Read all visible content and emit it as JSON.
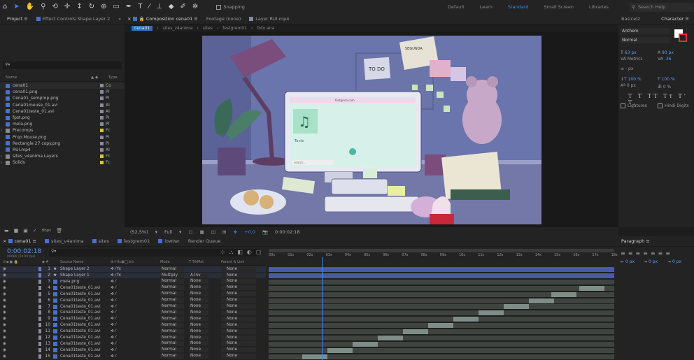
{
  "toolbar": {
    "snapping": "Snapping",
    "workspaces": [
      "Default",
      "Learn",
      "Standard",
      "Small Screen",
      "Libraries"
    ],
    "active_workspace": "Standard",
    "search_placeholder": "Search Help"
  },
  "project_panel": {
    "tabs": [
      "Project",
      "Effect Controls Shape Layer 2"
    ],
    "col_name": "Name",
    "col_type": "Type",
    "items": [
      {
        "name": "cena01",
        "type": "Co",
        "color": "#8a8aa0",
        "icon": "composition-icon"
      },
      {
        "name": "cena01.png",
        "type": "PI",
        "color": "#8a8aa0",
        "icon": "image-icon"
      },
      {
        "name": "Cena01_semprop.png",
        "type": "PI",
        "color": "#8a8aa0",
        "icon": "image-icon"
      },
      {
        "name": "Cena01mouse_01.avi",
        "type": "AI",
        "color": "#8a8aa0",
        "icon": "footage-icon"
      },
      {
        "name": "Cena01teste_01.avi",
        "type": "AI",
        "color": "#8a8aa0",
        "icon": "footage-icon"
      },
      {
        "name": "fpst.png",
        "type": "PI",
        "color": "#8a8aa0",
        "icon": "image-icon"
      },
      {
        "name": "mela.png",
        "type": "PI",
        "color": "#8a8aa0",
        "icon": "image-icon"
      },
      {
        "name": "Precomps",
        "type": "Fc",
        "color": "#d8c23a",
        "icon": "folder-icon"
      },
      {
        "name": "Prop Mouse.png",
        "type": "PI",
        "color": "#8a8aa0",
        "icon": "image-icon"
      },
      {
        "name": "Rectangle 27 copy.png",
        "type": "PI",
        "color": "#8a8aa0",
        "icon": "image-icon"
      },
      {
        "name": "RUI.mp4",
        "type": "AI",
        "color": "#8a8aa0",
        "icon": "footage-icon"
      },
      {
        "name": "sites_v4anima Layers",
        "type": "Fc",
        "color": "#d8c23a",
        "icon": "folder-icon"
      },
      {
        "name": "Solids",
        "type": "Fc",
        "color": "#d8c23a",
        "icon": "folder-icon"
      }
    ],
    "footer": "8bpc"
  },
  "comp_panel": {
    "tabs": [
      "Composition cena01",
      "Footage (none)",
      "Layer RUI.mp4"
    ],
    "breadcrumb": [
      "cena01",
      "sites_v4anima",
      "sites",
      "festgrem01",
      "foto ana"
    ]
  },
  "viewer_bar": {
    "zoom": "(52,5%)",
    "resolution": "Full",
    "exposure": "+0,0",
    "timecode": "0:00:02:18"
  },
  "artwork": {
    "note_title": "SEGUNDA",
    "note_todo": "TO DO",
    "app_title": "Tunts",
    "site": "festgrem.com",
    "search": "search..."
  },
  "character_panel": {
    "tabs": [
      "Basicel2",
      "Character"
    ],
    "font": "Anthem",
    "style": "Normal",
    "size": "63 px",
    "leading": "90 px",
    "kerning": "Metrics",
    "tracking": "-36",
    "vscale": "100 %",
    "hscale": "100 %",
    "baseline": "0 px",
    "tsume": "0 %",
    "unit": "- px",
    "ligatures": "Ligatures",
    "hindi": "Hindi Digits"
  },
  "paragraph_panel": {
    "title": "Paragraph",
    "indent": "0 px"
  },
  "timeline": {
    "tabs": [
      "cena01",
      "sites_v4anima",
      "sites",
      "festgrem01",
      "lowtwr",
      "Render Queue"
    ],
    "timecode": "0:00:02:18",
    "fps": "00066 (24.00 fps)",
    "col_source": "Source Name",
    "col_mode": "Mode",
    "col_trkmat": "T TrkMat",
    "col_parent": "Parent & Link",
    "ruler": [
      "00s",
      "01s",
      "02s",
      "03s",
      "04s",
      "05s",
      "06s",
      "07s",
      "08s",
      "09s",
      "10s",
      "11s",
      "12s",
      "13s",
      "14s",
      "15s",
      "16s",
      "17s",
      "18s"
    ],
    "layers": [
      {
        "n": "1",
        "name": "Shape Layer 2",
        "mode": "Normal",
        "trk": "",
        "parent": "None",
        "icon": "star-icon",
        "c": "#6a7cc8"
      },
      {
        "n": "2",
        "name": "Shape Layer 1",
        "mode": "Multiply",
        "trk": "A.Inv",
        "parent": "None",
        "icon": "star-icon",
        "c": "#6a7cc8"
      },
      {
        "n": "3",
        "name": "mela.png",
        "mode": "Normal",
        "trk": "None",
        "parent": "None",
        "icon": "image-icon",
        "c": "#8a8aa0"
      },
      {
        "n": "4",
        "name": "Cena01teste_01.avi",
        "mode": "Normal",
        "trk": "None",
        "parent": "None",
        "icon": "footage-icon",
        "c": "#8a8aa0"
      },
      {
        "n": "5",
        "name": "Cena01teste_01.avi",
        "mode": "Normal",
        "trk": "None",
        "parent": "None",
        "icon": "footage-icon",
        "c": "#8a8aa0"
      },
      {
        "n": "6",
        "name": "Cena01teste_01.avi",
        "mode": "Normal",
        "trk": "None",
        "parent": "None",
        "icon": "footage-icon",
        "c": "#8a8aa0"
      },
      {
        "n": "7",
        "name": "Cena01teste_01.avi",
        "mode": "Normal",
        "trk": "None",
        "parent": "None",
        "icon": "footage-icon",
        "c": "#8a8aa0"
      },
      {
        "n": "8",
        "name": "Cena01teste_01.avi",
        "mode": "Normal",
        "trk": "None",
        "parent": "None",
        "icon": "footage-icon",
        "c": "#8a8aa0"
      },
      {
        "n": "9",
        "name": "Cena01teste_01.avi",
        "mode": "Normal",
        "trk": "None",
        "parent": "None",
        "icon": "footage-icon",
        "c": "#8a8aa0"
      },
      {
        "n": "10",
        "name": "Cena01teste_01.avi",
        "mode": "Normal",
        "trk": "None",
        "parent": "None",
        "icon": "footage-icon",
        "c": "#8a8aa0"
      },
      {
        "n": "11",
        "name": "Cena01teste_01.avi",
        "mode": "Normal",
        "trk": "None",
        "parent": "None",
        "icon": "footage-icon",
        "c": "#8a8aa0"
      },
      {
        "n": "12",
        "name": "Cena01teste_01.avi",
        "mode": "Normal",
        "trk": "None",
        "parent": "None",
        "icon": "footage-icon",
        "c": "#8a8aa0"
      },
      {
        "n": "13",
        "name": "Cena01teste_01.avi",
        "mode": "Normal",
        "trk": "None",
        "parent": "None",
        "icon": "footage-icon",
        "c": "#8a8aa0"
      },
      {
        "n": "14",
        "name": "Cena01teste_01.avi",
        "mode": "Normal",
        "trk": "None",
        "parent": "None",
        "icon": "footage-icon",
        "c": "#8a8aa0"
      },
      {
        "n": "15",
        "name": "Cena01teste_01.avi",
        "mode": "Normal",
        "trk": "None",
        "parent": "None",
        "icon": "footage-icon",
        "c": "#8a8aa0"
      }
    ]
  },
  "colors": {
    "accent": "#2e8cff",
    "viewer_bg": "#5f6aa6",
    "bar_blue": "#4b5aa8",
    "bar_gray": "#5d6a67",
    "bar_light": "#7f8d88"
  }
}
